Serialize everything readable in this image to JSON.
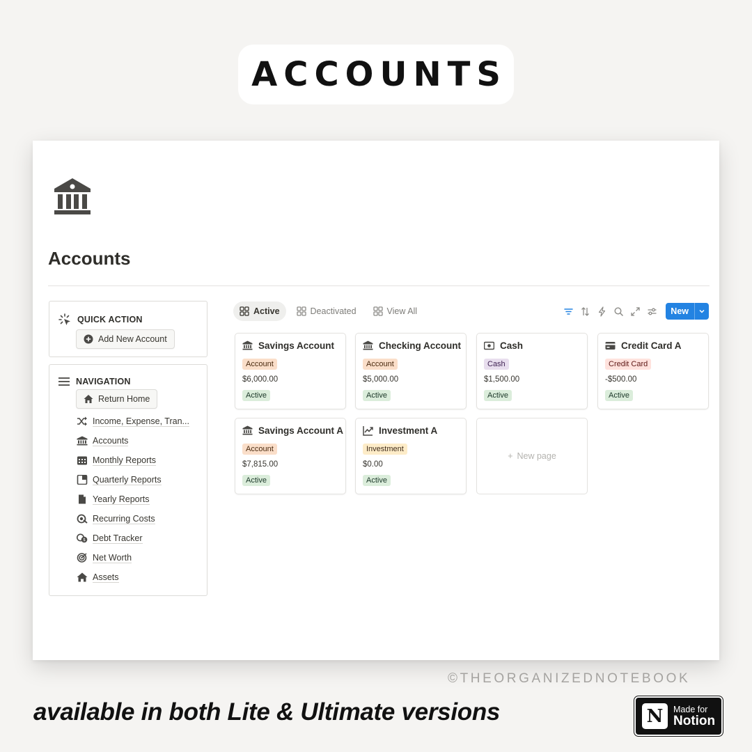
{
  "header": {
    "title": "ACCOUNTS"
  },
  "page": {
    "icon": "bank-icon",
    "title": "Accounts"
  },
  "quick_action": {
    "heading": "QUICK ACTION",
    "button_label": "Add New Account"
  },
  "navigation": {
    "heading": "NAVIGATION",
    "home_label": "Return Home",
    "items": [
      {
        "label": "Income, Expense, Tran...",
        "icon": "shuffle-icon"
      },
      {
        "label": "Accounts",
        "icon": "bank-icon"
      },
      {
        "label": "Monthly Reports",
        "icon": "calendar-icon"
      },
      {
        "label": "Quarterly Reports",
        "icon": "quarter-icon"
      },
      {
        "label": "Yearly Reports",
        "icon": "document-icon"
      },
      {
        "label": "Recurring Costs",
        "icon": "recurring-icon"
      },
      {
        "label": "Debt Tracker",
        "icon": "coins-icon"
      },
      {
        "label": "Net Worth",
        "icon": "target-icon"
      },
      {
        "label": "Assets",
        "icon": "house-icon"
      }
    ]
  },
  "views": {
    "tabs": [
      {
        "label": "Active",
        "active": true
      },
      {
        "label": "Deactivated",
        "active": false
      },
      {
        "label": "View All",
        "active": false
      }
    ],
    "new_label": "New",
    "accent": "#2383e2"
  },
  "cards": [
    {
      "title": "Savings Account",
      "icon": "bank-icon",
      "type": "Account",
      "amount": "$6,000.00",
      "status": "Active"
    },
    {
      "title": "Checking Account",
      "icon": "bank-icon",
      "type": "Account",
      "amount": "$5,000.00",
      "status": "Active"
    },
    {
      "title": "Cash",
      "icon": "cash-icon",
      "type": "Cash",
      "amount": "$1,500.00",
      "status": "Active"
    },
    {
      "title": "Credit Card A",
      "icon": "credit-card-icon",
      "type": "Credit Card",
      "amount": "-$500.00",
      "status": "Active"
    },
    {
      "title": "Savings Account A",
      "icon": "bank-icon",
      "type": "Account",
      "amount": "$7,815.00",
      "status": "Active"
    },
    {
      "title": "Investment A",
      "icon": "chart-icon",
      "type": "Investment",
      "amount": "$0.00",
      "status": "Active"
    }
  ],
  "tag_colors": {
    "Account": {
      "bg": "#fadec9",
      "fg": "#49290e"
    },
    "Cash": {
      "bg": "#e8deee",
      "fg": "#412454"
    },
    "Credit Card": {
      "bg": "#ffe2dd",
      "fg": "#5d1715"
    },
    "Investment": {
      "bg": "#fdecc8",
      "fg": "#402c1b"
    }
  },
  "new_page_label": "New page",
  "footer": {
    "watermark": "©THEORGANIZEDNOTEBOOK",
    "tagline": "available in both Lite & Ultimate versions",
    "badge_small": "Made for",
    "badge_big": "Notion",
    "badge_logo": "N"
  }
}
